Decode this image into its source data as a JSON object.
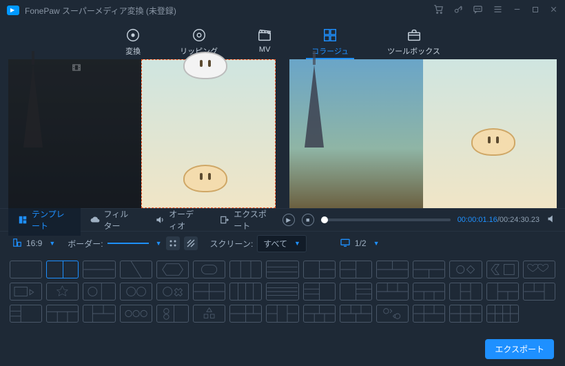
{
  "app": {
    "title": "FonePaw スーパーメディア変換 (未登録)"
  },
  "mainTabs": [
    {
      "id": "convert",
      "label": "変換"
    },
    {
      "id": "ripping",
      "label": "リッピング"
    },
    {
      "id": "mv",
      "label": "MV"
    },
    {
      "id": "collage",
      "label": "コラージュ",
      "active": true
    },
    {
      "id": "toolbox",
      "label": "ツールボックス"
    }
  ],
  "subTabs": [
    {
      "id": "template",
      "label": "テンプレート",
      "active": true
    },
    {
      "id": "filter",
      "label": "フィルター"
    },
    {
      "id": "audio",
      "label": "オーディオ"
    },
    {
      "id": "export",
      "label": "エクスポート"
    }
  ],
  "player": {
    "current": "00:00:01.16",
    "total": "00:24:30.23"
  },
  "options": {
    "aspect": "16:9",
    "borderLabel": "ボーダー:",
    "screenLabel": "スクリーン:",
    "screenValue": "すべて",
    "pageLabel": "1/2"
  },
  "footer": {
    "exportLabel": "エクスポート"
  },
  "titlebarIcons": [
    "cart-icon",
    "key-icon",
    "chat-icon",
    "menu-icon",
    "minimize-icon",
    "maximize-icon",
    "close-icon"
  ]
}
